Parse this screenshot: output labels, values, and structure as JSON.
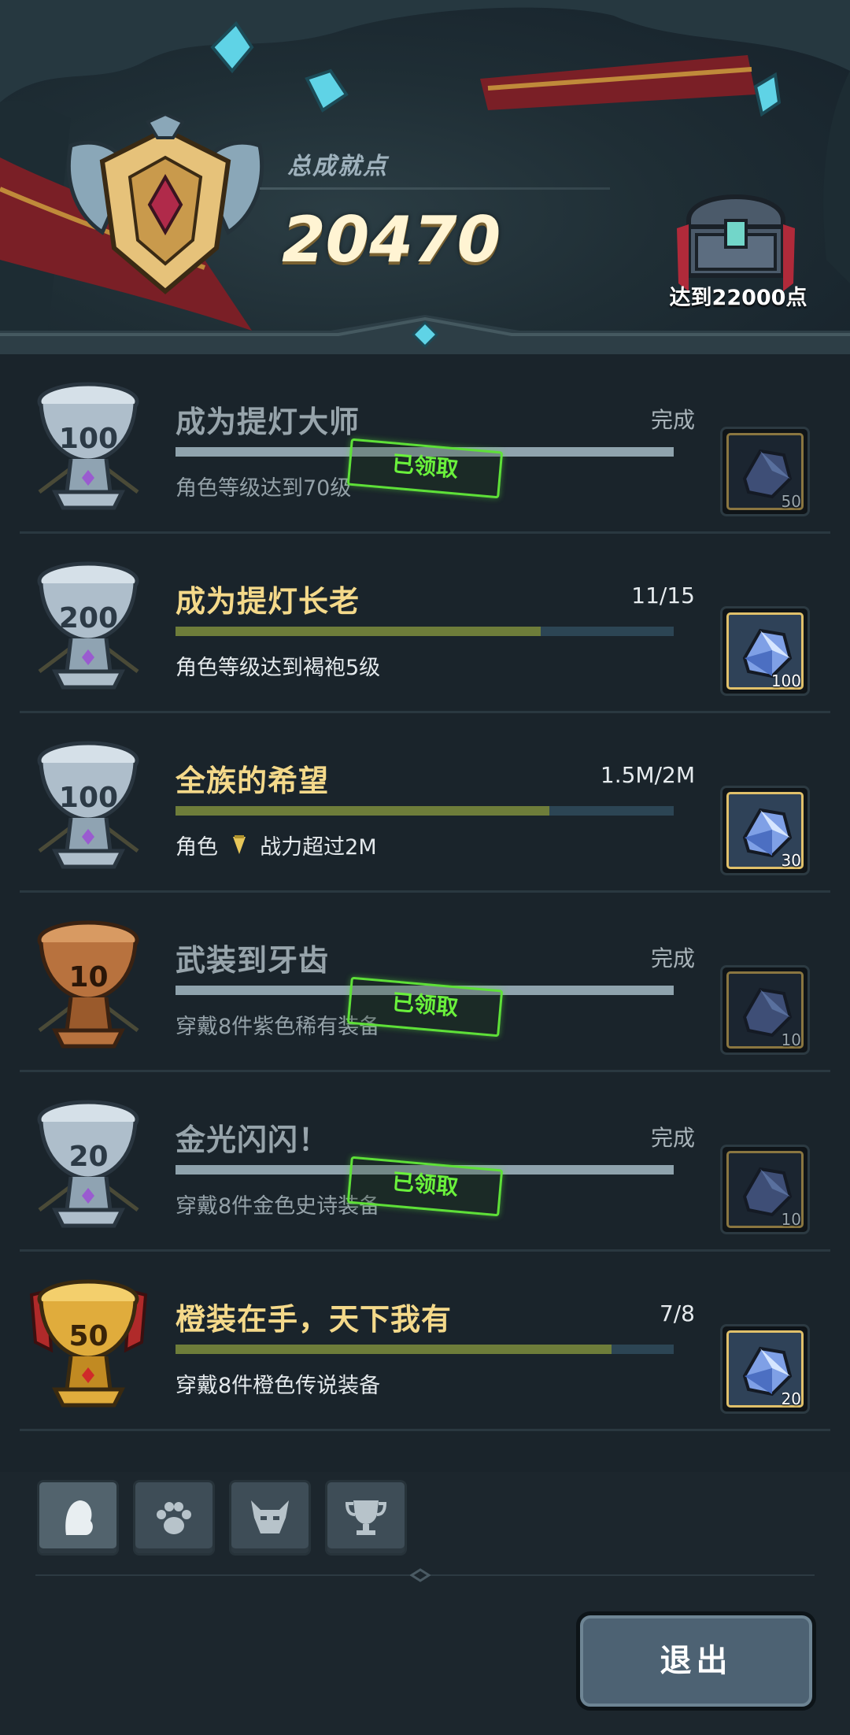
{
  "header": {
    "title": "总成就点",
    "total_points": "20470",
    "chest_label": "达到22000点"
  },
  "achievements": [
    {
      "trophy": "100",
      "trophy_tier": "silver",
      "title": "成为提灯大师",
      "progress": "完成",
      "description": "角色等级达到70级",
      "progress_fraction": 1.0,
      "completed": true,
      "stamp": "已领取",
      "reward_count": "50"
    },
    {
      "trophy": "200",
      "trophy_tier": "silver",
      "title": "成为提灯长老",
      "progress": "11/15",
      "description": "角色等级达到褐袍5级",
      "progress_fraction": 0.7333,
      "completed": false,
      "stamp": "",
      "reward_count": "100"
    },
    {
      "trophy": "100",
      "trophy_tier": "silver",
      "title": "全族的希望",
      "progress": "1.5M/2M",
      "description": "角色",
      "description_suffix": "战力超过2M",
      "progress_fraction": 0.75,
      "completed": false,
      "stamp": "",
      "reward_count": "30"
    },
    {
      "trophy": "10",
      "trophy_tier": "bronze",
      "title": "武装到牙齿",
      "progress": "完成",
      "description": "穿戴8件紫色稀有装备",
      "progress_fraction": 1.0,
      "completed": true,
      "stamp": "已领取",
      "reward_count": "10"
    },
    {
      "trophy": "20",
      "trophy_tier": "silver",
      "title": "金光闪闪！",
      "progress": "完成",
      "description": "穿戴8件金色史诗装备",
      "progress_fraction": 1.0,
      "completed": true,
      "stamp": "已领取",
      "reward_count": "10"
    },
    {
      "trophy": "50",
      "trophy_tier": "gold",
      "title": "橙装在手，天下我有",
      "progress": "7/8",
      "description": "穿戴8件橙色传说装备",
      "progress_fraction": 0.875,
      "completed": false,
      "stamp": "",
      "reward_count": "20"
    }
  ],
  "tabs": [
    {
      "icon": "character-head-icon",
      "active": true
    },
    {
      "icon": "paw-icon",
      "active": false
    },
    {
      "icon": "demon-mask-icon",
      "active": false
    },
    {
      "icon": "trophy-icon",
      "active": false
    }
  ],
  "exit_label": "退出",
  "colors": {
    "background": "#1a242b",
    "title_gold": "#f4d98a",
    "stamp_green": "#5ee038",
    "bar_fill": "#6e7d3a",
    "bar_track": "#2c4554"
  }
}
